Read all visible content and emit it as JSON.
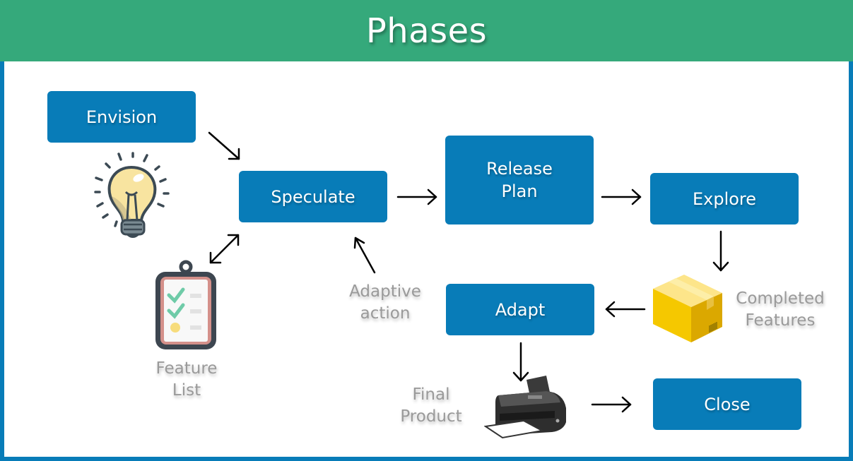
{
  "header": {
    "title": "Phases"
  },
  "phases": {
    "envision": "Envision",
    "speculate": "Speculate",
    "release_plan": "Release\nPlan",
    "explore": "Explore",
    "adapt": "Adapt",
    "close": "Close"
  },
  "labels": {
    "feature_list": "Feature\nList",
    "adaptive_action": "Adaptive\naction",
    "completed_features": "Completed\nFeatures",
    "final_product": "Final\nProduct"
  },
  "icons": {
    "envision_icon": "lightbulb-icon",
    "feature_list_icon": "clipboard-checklist-icon",
    "completed_features_icon": "package-box-icon",
    "final_product_icon": "printer-icon"
  },
  "colors": {
    "header": "#35a97b",
    "phase_box": "#087cb8",
    "frame": "#087cb8",
    "label_text": "#9a9a9a"
  }
}
